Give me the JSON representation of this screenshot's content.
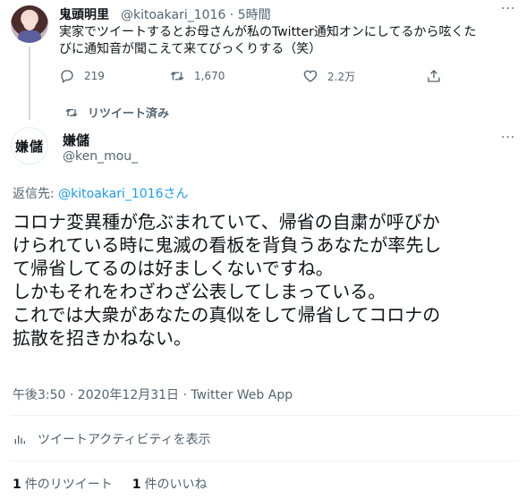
{
  "parent_tweet": {
    "name": "鬼頭明里",
    "handle_time": "@kitoakari_1016 · 5時間",
    "text_lines": [
      "実家でツイートするとお母さんが私のTwitter通知オンにしてるから呟くた",
      "びに通知音が聞こえて来てびっくりする（笑）"
    ],
    "more": "···",
    "reply_count": "219",
    "retweet_count": "1,670",
    "like_count": "2.2万"
  },
  "retweet_status": "リツイート済み",
  "main_tweet": {
    "avatar_text": "嫌儲",
    "name": "嫌儲",
    "handle": "@ken_mou_",
    "more": "···",
    "reply_prefix": "返信先: ",
    "reply_handle": "@kitoakari_1016",
    "reply_suffix": "さん",
    "text_lines": [
      "コロナ変異種が危ぶまれていて、帰省の自粛が呼びか",
      "けられている時に鬼滅の看板を背負うあなたが率先し",
      "て帰省してるのは好ましくないですね。",
      "しかもそれをわざわざ公表してしまっている。",
      "これでは大衆があなたの真似をして帰省してコロナの",
      "拡散を招きかねない。"
    ],
    "timestamp": "午後3:50 · 2020年12月31日 · ",
    "client": "Twitter Web App",
    "analytics_label": "ツイートアクティビティを表示",
    "retweets_num": "1",
    "retweets_label": "件のリツイート",
    "likes_num": "1",
    "likes_label": "件のいいね"
  },
  "icons": {
    "reply": "reply-icon",
    "retweet": "retweet-icon",
    "like": "heart-icon",
    "share": "share-icon",
    "analytics": "analytics-icon"
  },
  "colors": {
    "text": "#0f1419",
    "muted": "#536471",
    "link": "#1d9bf0",
    "divider": "#eff3f4"
  }
}
